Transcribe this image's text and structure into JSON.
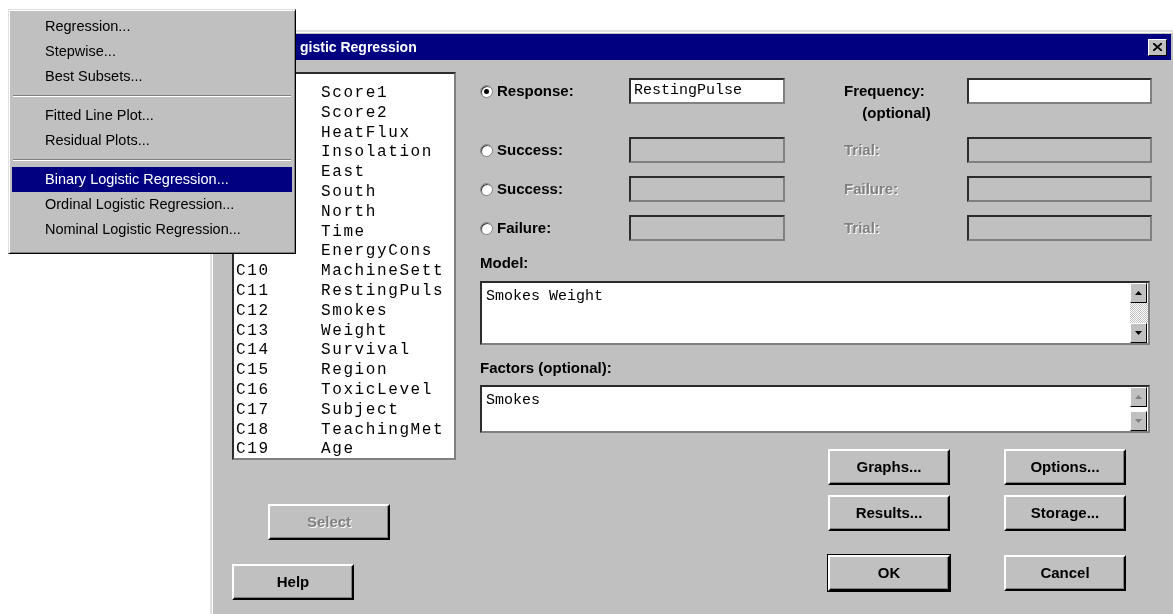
{
  "menu": {
    "items": [
      {
        "kind": "item",
        "label": "Regression...",
        "selected": false
      },
      {
        "kind": "item",
        "label": "Stepwise...",
        "selected": false
      },
      {
        "kind": "item",
        "label": "Best Subsets...",
        "selected": false
      },
      {
        "kind": "separator"
      },
      {
        "kind": "item",
        "label": "Fitted Line Plot...",
        "selected": false
      },
      {
        "kind": "item",
        "label": "Residual Plots...",
        "selected": false
      },
      {
        "kind": "separator"
      },
      {
        "kind": "item",
        "label": "Binary Logistic Regression...",
        "selected": true
      },
      {
        "kind": "item",
        "label": "Ordinal Logistic Regression...",
        "selected": false
      },
      {
        "kind": "item",
        "label": "Nominal Logistic Regression...",
        "selected": false
      }
    ]
  },
  "dialog": {
    "title": "gistic Regression",
    "variables": [
      {
        "name": "Score1"
      },
      {
        "name": "Score2"
      },
      {
        "name": "HeatFlux"
      },
      {
        "name": "Insolation"
      },
      {
        "name": "East"
      },
      {
        "name": "South"
      },
      {
        "name": "North"
      },
      {
        "name": "Time"
      },
      {
        "name": "EnergyCons"
      },
      {
        "column": "C10",
        "name": "MachineSett"
      },
      {
        "column": "C11",
        "name": "RestingPuls"
      },
      {
        "column": "C12",
        "name": "Smokes"
      },
      {
        "column": "C13",
        "name": "Weight"
      },
      {
        "column": "C14",
        "name": "Survival"
      },
      {
        "column": "C15",
        "name": "Region"
      },
      {
        "column": "C16",
        "name": "ToxicLevel"
      },
      {
        "column": "C17",
        "name": "Subject"
      },
      {
        "column": "C18",
        "name": "TeachingMet"
      },
      {
        "column": "C19",
        "name": "Age"
      }
    ],
    "rows": [
      {
        "label": "Response:",
        "selected": true,
        "value": "RestingPulse",
        "disabled": false,
        "side_label": "Frequency:",
        "side_note": "(optional)",
        "side_disabled": false
      },
      {
        "label": "Success:",
        "selected": false,
        "disabled": true,
        "side_label": "Trial:",
        "side_disabled": true
      },
      {
        "label": "Success:",
        "selected": false,
        "disabled": true,
        "side_label": "Failure:",
        "side_disabled": true
      },
      {
        "label": "Failure:",
        "selected": false,
        "disabled": true,
        "side_label": "Trial:",
        "side_disabled": true
      }
    ],
    "model": {
      "label": "Model:",
      "value": "Smokes Weight"
    },
    "factors": {
      "label": "Factors (optional):",
      "value": "Smokes"
    },
    "select_button": {
      "label": "Select",
      "disabled": true
    },
    "help_button": {
      "label": "Help",
      "disabled": false
    },
    "buttons": [
      {
        "label": "Graphs...",
        "default": false
      },
      {
        "label": "Options...",
        "default": false
      },
      {
        "label": "Results...",
        "default": false
      },
      {
        "label": "Storage...",
        "default": false
      },
      {
        "label": "OK",
        "default": true
      },
      {
        "label": "Cancel",
        "default": false
      }
    ]
  }
}
